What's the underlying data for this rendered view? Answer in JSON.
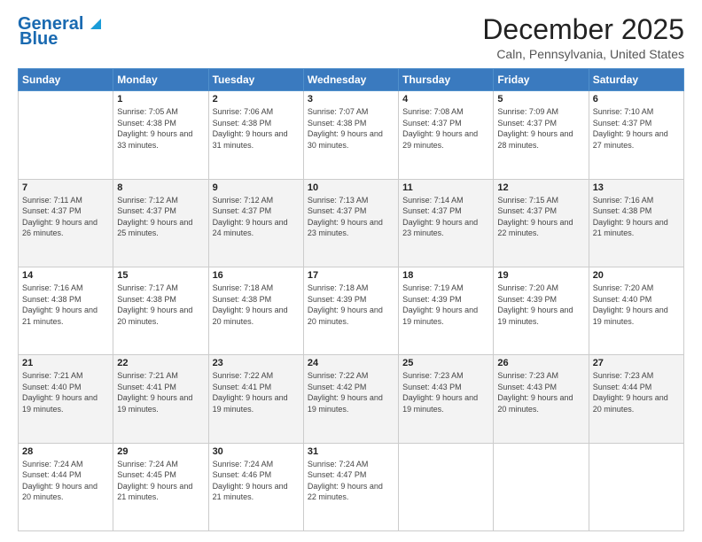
{
  "header": {
    "logo_line1": "General",
    "logo_line2": "Blue",
    "month_title": "December 2025",
    "location": "Caln, Pennsylvania, United States"
  },
  "days_of_week": [
    "Sunday",
    "Monday",
    "Tuesday",
    "Wednesday",
    "Thursday",
    "Friday",
    "Saturday"
  ],
  "weeks": [
    [
      {
        "day": "",
        "sunrise": "",
        "sunset": "",
        "daylight": ""
      },
      {
        "day": "1",
        "sunrise": "Sunrise: 7:05 AM",
        "sunset": "Sunset: 4:38 PM",
        "daylight": "Daylight: 9 hours and 33 minutes."
      },
      {
        "day": "2",
        "sunrise": "Sunrise: 7:06 AM",
        "sunset": "Sunset: 4:38 PM",
        "daylight": "Daylight: 9 hours and 31 minutes."
      },
      {
        "day": "3",
        "sunrise": "Sunrise: 7:07 AM",
        "sunset": "Sunset: 4:38 PM",
        "daylight": "Daylight: 9 hours and 30 minutes."
      },
      {
        "day": "4",
        "sunrise": "Sunrise: 7:08 AM",
        "sunset": "Sunset: 4:37 PM",
        "daylight": "Daylight: 9 hours and 29 minutes."
      },
      {
        "day": "5",
        "sunrise": "Sunrise: 7:09 AM",
        "sunset": "Sunset: 4:37 PM",
        "daylight": "Daylight: 9 hours and 28 minutes."
      },
      {
        "day": "6",
        "sunrise": "Sunrise: 7:10 AM",
        "sunset": "Sunset: 4:37 PM",
        "daylight": "Daylight: 9 hours and 27 minutes."
      }
    ],
    [
      {
        "day": "7",
        "sunrise": "Sunrise: 7:11 AM",
        "sunset": "Sunset: 4:37 PM",
        "daylight": "Daylight: 9 hours and 26 minutes."
      },
      {
        "day": "8",
        "sunrise": "Sunrise: 7:12 AM",
        "sunset": "Sunset: 4:37 PM",
        "daylight": "Daylight: 9 hours and 25 minutes."
      },
      {
        "day": "9",
        "sunrise": "Sunrise: 7:12 AM",
        "sunset": "Sunset: 4:37 PM",
        "daylight": "Daylight: 9 hours and 24 minutes."
      },
      {
        "day": "10",
        "sunrise": "Sunrise: 7:13 AM",
        "sunset": "Sunset: 4:37 PM",
        "daylight": "Daylight: 9 hours and 23 minutes."
      },
      {
        "day": "11",
        "sunrise": "Sunrise: 7:14 AM",
        "sunset": "Sunset: 4:37 PM",
        "daylight": "Daylight: 9 hours and 23 minutes."
      },
      {
        "day": "12",
        "sunrise": "Sunrise: 7:15 AM",
        "sunset": "Sunset: 4:37 PM",
        "daylight": "Daylight: 9 hours and 22 minutes."
      },
      {
        "day": "13",
        "sunrise": "Sunrise: 7:16 AM",
        "sunset": "Sunset: 4:38 PM",
        "daylight": "Daylight: 9 hours and 21 minutes."
      }
    ],
    [
      {
        "day": "14",
        "sunrise": "Sunrise: 7:16 AM",
        "sunset": "Sunset: 4:38 PM",
        "daylight": "Daylight: 9 hours and 21 minutes."
      },
      {
        "day": "15",
        "sunrise": "Sunrise: 7:17 AM",
        "sunset": "Sunset: 4:38 PM",
        "daylight": "Daylight: 9 hours and 20 minutes."
      },
      {
        "day": "16",
        "sunrise": "Sunrise: 7:18 AM",
        "sunset": "Sunset: 4:38 PM",
        "daylight": "Daylight: 9 hours and 20 minutes."
      },
      {
        "day": "17",
        "sunrise": "Sunrise: 7:18 AM",
        "sunset": "Sunset: 4:39 PM",
        "daylight": "Daylight: 9 hours and 20 minutes."
      },
      {
        "day": "18",
        "sunrise": "Sunrise: 7:19 AM",
        "sunset": "Sunset: 4:39 PM",
        "daylight": "Daylight: 9 hours and 19 minutes."
      },
      {
        "day": "19",
        "sunrise": "Sunrise: 7:20 AM",
        "sunset": "Sunset: 4:39 PM",
        "daylight": "Daylight: 9 hours and 19 minutes."
      },
      {
        "day": "20",
        "sunrise": "Sunrise: 7:20 AM",
        "sunset": "Sunset: 4:40 PM",
        "daylight": "Daylight: 9 hours and 19 minutes."
      }
    ],
    [
      {
        "day": "21",
        "sunrise": "Sunrise: 7:21 AM",
        "sunset": "Sunset: 4:40 PM",
        "daylight": "Daylight: 9 hours and 19 minutes."
      },
      {
        "day": "22",
        "sunrise": "Sunrise: 7:21 AM",
        "sunset": "Sunset: 4:41 PM",
        "daylight": "Daylight: 9 hours and 19 minutes."
      },
      {
        "day": "23",
        "sunrise": "Sunrise: 7:22 AM",
        "sunset": "Sunset: 4:41 PM",
        "daylight": "Daylight: 9 hours and 19 minutes."
      },
      {
        "day": "24",
        "sunrise": "Sunrise: 7:22 AM",
        "sunset": "Sunset: 4:42 PM",
        "daylight": "Daylight: 9 hours and 19 minutes."
      },
      {
        "day": "25",
        "sunrise": "Sunrise: 7:23 AM",
        "sunset": "Sunset: 4:43 PM",
        "daylight": "Daylight: 9 hours and 19 minutes."
      },
      {
        "day": "26",
        "sunrise": "Sunrise: 7:23 AM",
        "sunset": "Sunset: 4:43 PM",
        "daylight": "Daylight: 9 hours and 20 minutes."
      },
      {
        "day": "27",
        "sunrise": "Sunrise: 7:23 AM",
        "sunset": "Sunset: 4:44 PM",
        "daylight": "Daylight: 9 hours and 20 minutes."
      }
    ],
    [
      {
        "day": "28",
        "sunrise": "Sunrise: 7:24 AM",
        "sunset": "Sunset: 4:44 PM",
        "daylight": "Daylight: 9 hours and 20 minutes."
      },
      {
        "day": "29",
        "sunrise": "Sunrise: 7:24 AM",
        "sunset": "Sunset: 4:45 PM",
        "daylight": "Daylight: 9 hours and 21 minutes."
      },
      {
        "day": "30",
        "sunrise": "Sunrise: 7:24 AM",
        "sunset": "Sunset: 4:46 PM",
        "daylight": "Daylight: 9 hours and 21 minutes."
      },
      {
        "day": "31",
        "sunrise": "Sunrise: 7:24 AM",
        "sunset": "Sunset: 4:47 PM",
        "daylight": "Daylight: 9 hours and 22 minutes."
      },
      {
        "day": "",
        "sunrise": "",
        "sunset": "",
        "daylight": ""
      },
      {
        "day": "",
        "sunrise": "",
        "sunset": "",
        "daylight": ""
      },
      {
        "day": "",
        "sunrise": "",
        "sunset": "",
        "daylight": ""
      }
    ]
  ]
}
